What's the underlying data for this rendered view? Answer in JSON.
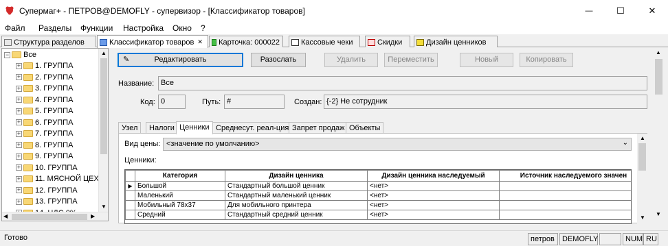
{
  "window": {
    "title": "Супермаг+ - ПЕТРОВ@DEMOFLY - супервизор - [Классификатор товаров]",
    "controls": {
      "minimize": "—",
      "maximize": "☐",
      "close": "✕"
    }
  },
  "menu": [
    "Файл",
    "Разделы",
    "Функции",
    "Настройка",
    "Окно",
    "?"
  ],
  "tabs": [
    {
      "label": "Структура разделов",
      "active": false
    },
    {
      "label": "Классификатор товаров",
      "active": true,
      "close": "✕"
    },
    {
      "label": "Карточка: 000022",
      "active": false
    },
    {
      "label": "Кассовые чеки",
      "active": false
    },
    {
      "label": "Скидки",
      "active": false
    },
    {
      "label": "Дизайн ценников",
      "active": false
    }
  ],
  "tree": {
    "root": "Все",
    "items": [
      "1. ГРУППА",
      "2. ГРУППА",
      "3. ГРУППА",
      "4. ГРУППА",
      "5. ГРУППА",
      "6. ГРУППА",
      "7. ГРУППА",
      "8. ГРУППА",
      "9. ГРУППА",
      "10. ГРУППА",
      "11. МЯСНОЙ ЦЕХ",
      "12. ГРУППА",
      "13. ГРУППА",
      "14. НДС 0%"
    ]
  },
  "toolbar": {
    "edit": "Редактировать",
    "send": "Разослать",
    "delete": "Удалить",
    "move": "Переместить",
    "new": "Новый",
    "copy": "Копировать"
  },
  "form": {
    "name_label": "Название:",
    "name_value": "Все",
    "code_label": "Код:",
    "code_value": "0",
    "path_label": "Путь:",
    "path_value": "#",
    "created_label": "Создан:",
    "created_value": "{-2} Не сотрудник"
  },
  "inner_tabs": [
    "Узел",
    "Налоги",
    "Ценники",
    "Среднесут. реал-ция",
    "Запрет продаж",
    "Объекты"
  ],
  "prices": {
    "type_label": "Вид цены:",
    "type_value": "<значение по умолчанию>",
    "labels_caption": "Ценники:",
    "columns": [
      "Категория",
      "Дизайн ценника",
      "Дизайн ценника наследуемый",
      "Источник наследуемого значен"
    ],
    "rows": [
      [
        "Большой",
        "Стандартный большой ценник",
        "<нет>",
        ""
      ],
      [
        "Маленький",
        "Стандартный маленький ценник",
        "<нет>",
        ""
      ],
      [
        "Мобильный 78x37",
        "Для мобильного принтера",
        "<нет>",
        ""
      ],
      [
        "Средний",
        "Стандартный средний ценник",
        "<нет>",
        ""
      ]
    ]
  },
  "status": {
    "ready": "Готово",
    "user": "петров",
    "db": "DEMOFLY",
    "num": "NUM",
    "lang": "RU"
  }
}
